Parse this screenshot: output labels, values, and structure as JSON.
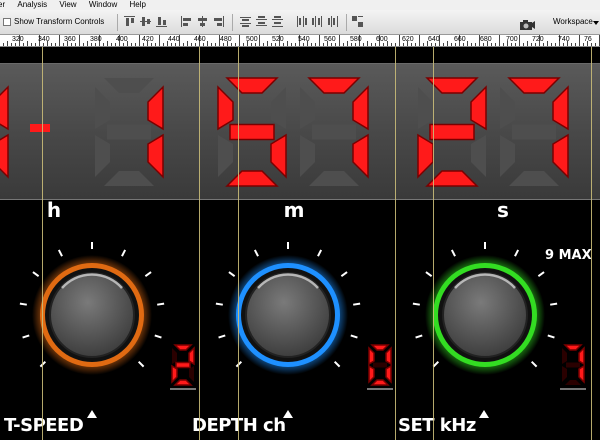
{
  "menu": {
    "items": [
      "er",
      "Analysis",
      "View",
      "Window",
      "Help"
    ]
  },
  "options": {
    "show_transform_controls": "Show Transform Controls",
    "workspace_label": "Workspace"
  },
  "ruler": {
    "labels": [
      "320",
      "340",
      "360",
      "380",
      "400",
      "420",
      "440",
      "460",
      "480",
      "500",
      "520",
      "540",
      "560",
      "580",
      "600",
      "620",
      "640",
      "660",
      "680",
      "700",
      "720",
      "740",
      "76"
    ]
  },
  "display": {
    "hours": "11",
    "minutes": "57",
    "seconds": "27",
    "digit_color": "#ff1a1a"
  },
  "units": {
    "h": "h",
    "m": "m",
    "s": "s"
  },
  "max_label": "9 MAX",
  "controls": [
    {
      "label": "T-SPEED",
      "value": "2",
      "ring_color": "#e06a12"
    },
    {
      "label": "DEPTH ch",
      "value": "0",
      "ring_color": "#1e90ff"
    },
    {
      "label": "SET kHz",
      "value": "7",
      "ring_color": "#33dd22"
    }
  ]
}
